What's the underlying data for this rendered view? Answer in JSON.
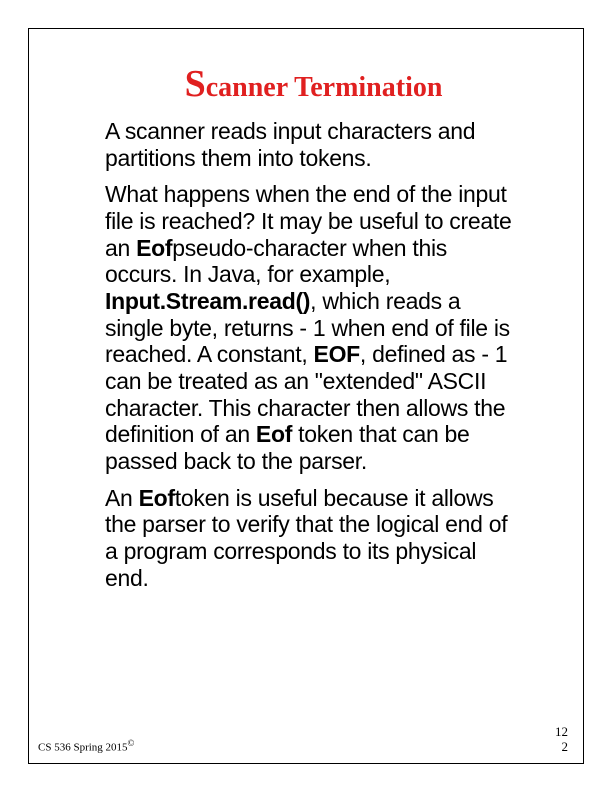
{
  "title_first": "S",
  "title_rest": "canner Termination",
  "para1": "A scanner reads input characters and partitions them into tokens.",
  "para2_a": "What happens when the end of the input file is reached? It may be useful to create an ",
  "para2_bold1": "Eof",
  "para2_b": "pseudo-character when this occurs. In Java, for example, ",
  "para2_bold2": "Input.Stream.read()",
  "para2_c": ", which reads a single byte, returns - 1 when end of file is reached. A constant, ",
  "para2_bold3": "EOF",
  "para2_d": ", defined as - 1 can be treated as an \"extended\" ASCII character. This character then allows the definition of an ",
  "para2_bold4": "Eof",
  "para2_e": " token that can be passed back to the parser.",
  "para3_a": "An ",
  "para3_bold1": "Eof",
  "para3_b": "token is useful because it allows the parser to verify that the logical end of a program corresponds to its physical end.",
  "footer_left": "CS 536  Spring 2015",
  "footer_copyright": "©",
  "page_num_top": "12",
  "page_num_bottom": "2"
}
